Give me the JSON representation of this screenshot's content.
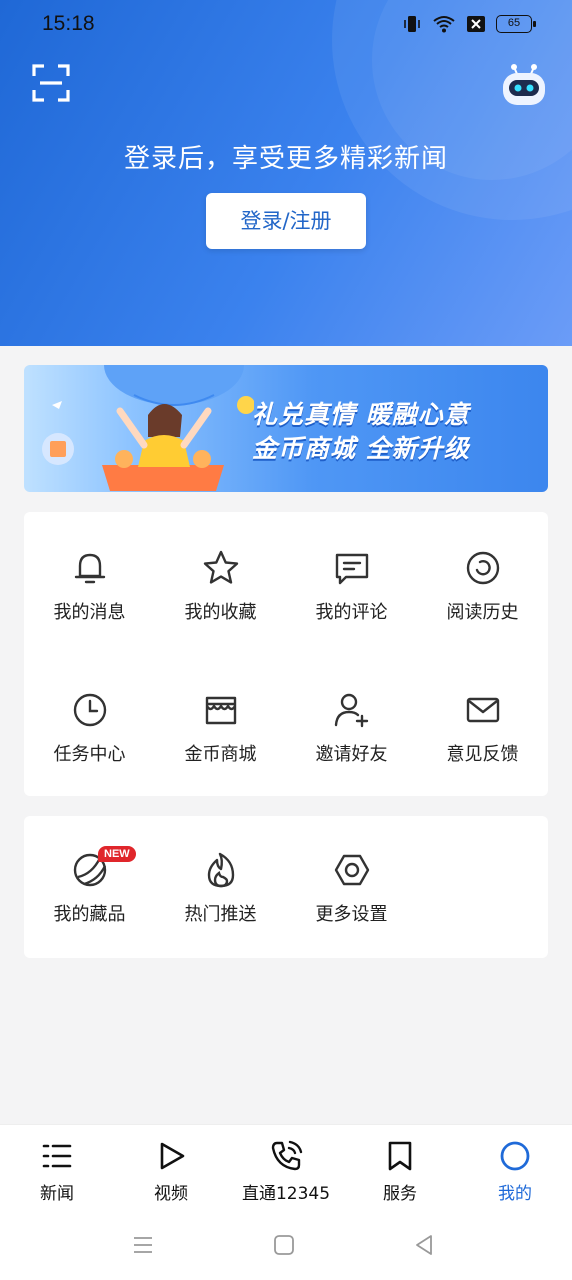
{
  "status_bar": {
    "time": "15:18",
    "battery": "65"
  },
  "hero": {
    "title": "登录后，享受更多精彩新闻",
    "login_label": "登录/注册"
  },
  "banner": {
    "line1": "礼兑真情 暖融心意",
    "line2": "金币商城 全新升级"
  },
  "menu_grid": [
    {
      "label": "我的消息",
      "icon": "bell-icon"
    },
    {
      "label": "我的收藏",
      "icon": "star-icon"
    },
    {
      "label": "我的评论",
      "icon": "comment-icon"
    },
    {
      "label": "阅读历史",
      "icon": "history-icon"
    },
    {
      "label": "任务中心",
      "icon": "clock-icon"
    },
    {
      "label": "金币商城",
      "icon": "shop-icon"
    },
    {
      "label": "邀请好友",
      "icon": "add-user-icon"
    },
    {
      "label": "意见反馈",
      "icon": "mail-icon"
    }
  ],
  "extra_grid": [
    {
      "label": "我的藏品",
      "icon": "collection-icon",
      "badge": "NEW"
    },
    {
      "label": "热门推送",
      "icon": "fire-icon"
    },
    {
      "label": "更多设置",
      "icon": "settings-icon"
    }
  ],
  "tabs": [
    {
      "label": "新闻",
      "icon": "news-list-icon"
    },
    {
      "label": "视频",
      "icon": "play-icon"
    },
    {
      "label": "直通12345",
      "icon": "phone-icon"
    },
    {
      "label": "服务",
      "icon": "bookmark-icon"
    },
    {
      "label": "我的",
      "icon": "profile-ring-icon",
      "active": true
    }
  ],
  "colors": {
    "accent": "#1f6ad8",
    "badge": "#e0262b"
  }
}
